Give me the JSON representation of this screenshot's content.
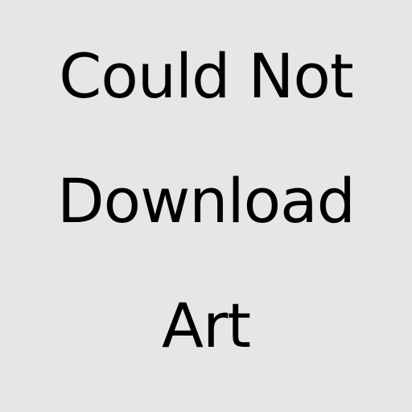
{
  "placeholder": {
    "lines": [
      "Could Not",
      "Download",
      "Art"
    ],
    "background_color": "#e6e6e6",
    "text_color": "#000000"
  }
}
